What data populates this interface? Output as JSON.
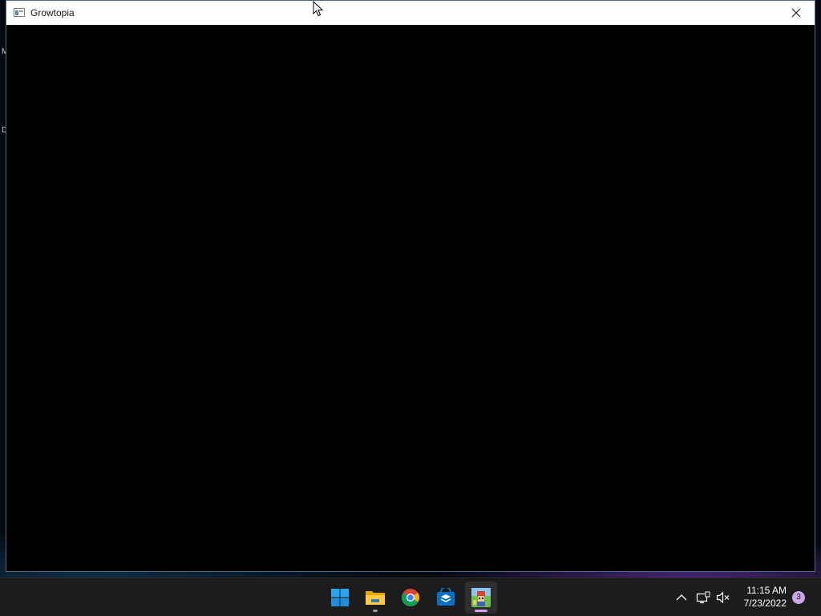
{
  "window": {
    "title": "Growtopia",
    "close_icon": "close-icon",
    "app_icon": "window-app-icon"
  },
  "desktop": {
    "fragment_1": "M",
    "fragment_2": "D"
  },
  "taskbar": {
    "apps": [
      {
        "name": "start",
        "icon": "windows-start-icon"
      },
      {
        "name": "file-explorer",
        "icon": "folder-icon",
        "running": true
      },
      {
        "name": "chrome",
        "icon": "chrome-icon"
      },
      {
        "name": "store",
        "icon": "store-icon"
      },
      {
        "name": "growtopia",
        "icon": "growtopia-icon",
        "running": true,
        "active": true
      }
    ],
    "tray": {
      "overflow_icon": "chevron-up-icon",
      "network_icon": "network-icon",
      "volume_icon": "volume-muted-icon"
    },
    "clock": {
      "time": "11:15 AM",
      "date": "7/23/2022"
    },
    "notification_count": "3"
  },
  "colors": {
    "accent_running": "#c9a7e8",
    "taskbar_bg": "#1c1c1c",
    "titlebar_bg": "#ffffff",
    "client_bg": "#000000"
  }
}
